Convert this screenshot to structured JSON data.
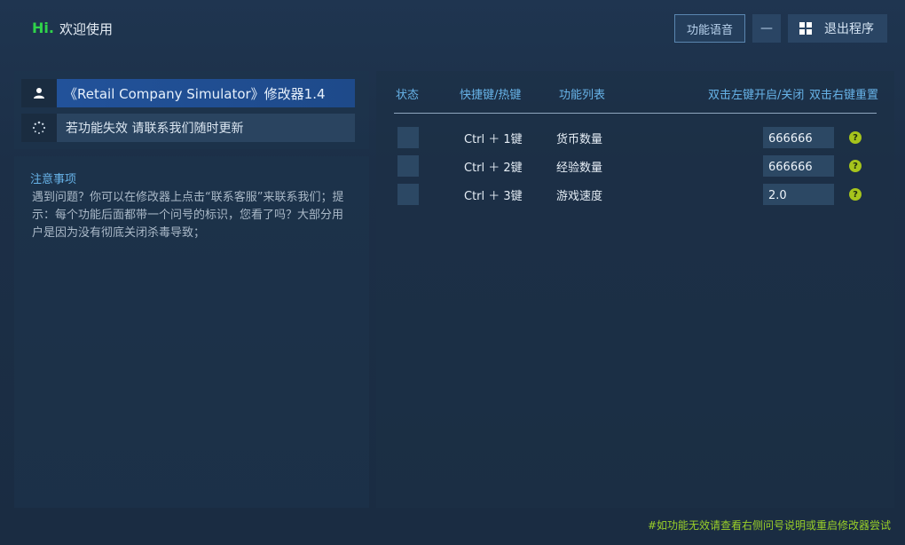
{
  "header": {
    "logo": "Hi.",
    "welcome": "欢迎使用",
    "voice_button": "功能语音",
    "minimize_button": "—",
    "exit_button": "退出程序"
  },
  "left": {
    "game_title": "《Retail Company Simulator》修改器1.4",
    "hint": "若功能失效  请联系我们随时更新",
    "notes_title": "注意事项",
    "notes_body": "遇到问题？你可以在修改器上点击“联系客服”来联系我们；提示：每个功能后面都带一个问号的标识，您看了吗？大部分用户是因为没有彻底关闭杀毒导致；"
  },
  "table": {
    "headers": {
      "status": "状态",
      "hotkey": "快捷键/热键",
      "function": "功能列表",
      "toggle": "双击左键开启/关闭",
      "reset": "双击右键重置"
    },
    "rows": [
      {
        "hotkey": "Ctrl ＋ 1键",
        "name": "货币数量",
        "value": "666666"
      },
      {
        "hotkey": "Ctrl ＋ 2键",
        "name": "经验数量",
        "value": "666666"
      },
      {
        "hotkey": "Ctrl ＋ 3键",
        "name": "游戏速度",
        "value": "2.0"
      }
    ]
  },
  "footer": "#如功能无效请查看右侧问号说明或重启修改器尝试",
  "colors": {
    "accent": "#67b3e8",
    "logo": "#2fd34a",
    "footer": "#9bd128",
    "help_icon": "#a6c41c"
  },
  "icons": [
    "user-icon",
    "spinner-icon",
    "windows-icon",
    "help-icon"
  ]
}
